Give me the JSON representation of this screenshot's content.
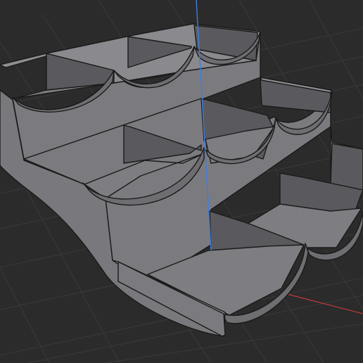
{
  "viewport": {
    "background": "#2b2b2b",
    "grid_color": "#3a3a3a",
    "axis_z_color": "#3e7de0",
    "axis_x_color": "#c23a3a"
  },
  "model": {
    "name": "stepped-tray",
    "tiers": 3,
    "cells_per_tier": 3,
    "face_colors": {
      "front": "#7b7b7f",
      "top": "#8f8f93",
      "floor": "#7e7e82",
      "inner_wall": "#5a5a5e",
      "edge": "#1a1a1a"
    }
  }
}
